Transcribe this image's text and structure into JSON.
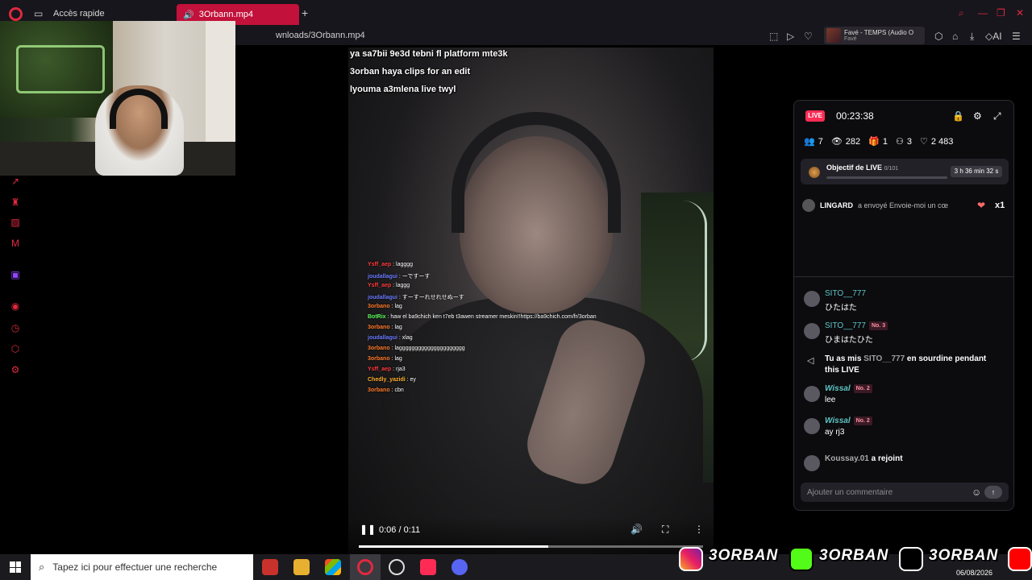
{
  "browser": {
    "quick_access_tab": "Accès rapide",
    "active_tab": "3Orbann.mp4",
    "address": "wnloads/3Orbann.mp4",
    "music_title": "Favé - TEMPS (Audio O",
    "music_artist": "Favé",
    "ai_label": "AI"
  },
  "video": {
    "captions": [
      "ya sa7bii 9e3d tebni fl platform mte3k",
      "3orban haya clips for an edit",
      "lyouma a3mlena live twyl"
    ],
    "chat": [
      {
        "user": "Ysff_aep",
        "text": "lagggg",
        "color": "#ff3b3b"
      },
      {
        "user": "joudallagui",
        "text": "ーですーす",
        "color": "#6b7bff"
      },
      {
        "user": "Ysff_aep",
        "text": "laggg",
        "color": "#ff3b3b"
      },
      {
        "user": "joudallagui",
        "text": "すーすーれせれせぬーす",
        "color": "#6b7bff"
      },
      {
        "user": "3orbano",
        "text": "lag",
        "color": "#ff7a2a"
      },
      {
        "user": "BotRix",
        "text": "haw el ba9chich ken t7eb t3awen streamer meskin!!https://ba9chich.com/fr/3orban",
        "color": "#5cff5c"
      },
      {
        "user": "3orbano",
        "text": "lag",
        "color": "#ff7a2a"
      },
      {
        "user": "joudallagui",
        "text": "xlag",
        "color": "#6b7bff"
      },
      {
        "user": "3orbano",
        "text": "laggggggggggggggggggggg",
        "color": "#ff7a2a"
      },
      {
        "user": "3orbano",
        "text": "lag",
        "color": "#ff7a2a"
      },
      {
        "user": "Ysff_aep",
        "text": "rja3",
        "color": "#ff3b3b"
      },
      {
        "user": "Chedly_yazidi",
        "text": "ey",
        "color": "#ffb02a"
      },
      {
        "user": "3orbano",
        "text": "cbn",
        "color": "#ff7a2a"
      }
    ],
    "time": "0:06 / 0:11",
    "progress": 0.55
  },
  "live": {
    "badge": "LIVE",
    "elapsed": "00:23:38",
    "stats": {
      "users": "7",
      "viewers": "282",
      "gifts": "1",
      "guests": "3",
      "likes": "2 483"
    },
    "goal_title": "Objectif de LIVE",
    "goal_count": "0/101",
    "goal_progress": 0.0,
    "goal_time": "3 h 36 min 32 s",
    "gift_user": "LINGARD",
    "gift_text": "a envoyé Envoie-moi un cœ",
    "gift_count": "x1",
    "messages": [
      {
        "user": "SITO__777",
        "text": "ひたはた"
      },
      {
        "user": "SITO__777",
        "badge": "No. 3",
        "text": "ひまはたひた"
      },
      {
        "user": "Wissal",
        "badge": "No. 2",
        "text": "lee"
      },
      {
        "user": "Wissal",
        "badge": "No. 2",
        "text": "ay rj3"
      }
    ],
    "mute_pre": "Tu as mis",
    "mute_user": "SITO__777",
    "mute_post": "en sourdine pendant this LIVE",
    "join_user": "Koussay.01",
    "join_text": "a rejoint",
    "comment_placeholder": "Ajouter un commentaire"
  },
  "taskbar": {
    "search_placeholder": "Tapez ici pour effectuer une recherche",
    "date": "06/08/2026"
  },
  "overlay": {
    "handle": "3ORBAN"
  }
}
